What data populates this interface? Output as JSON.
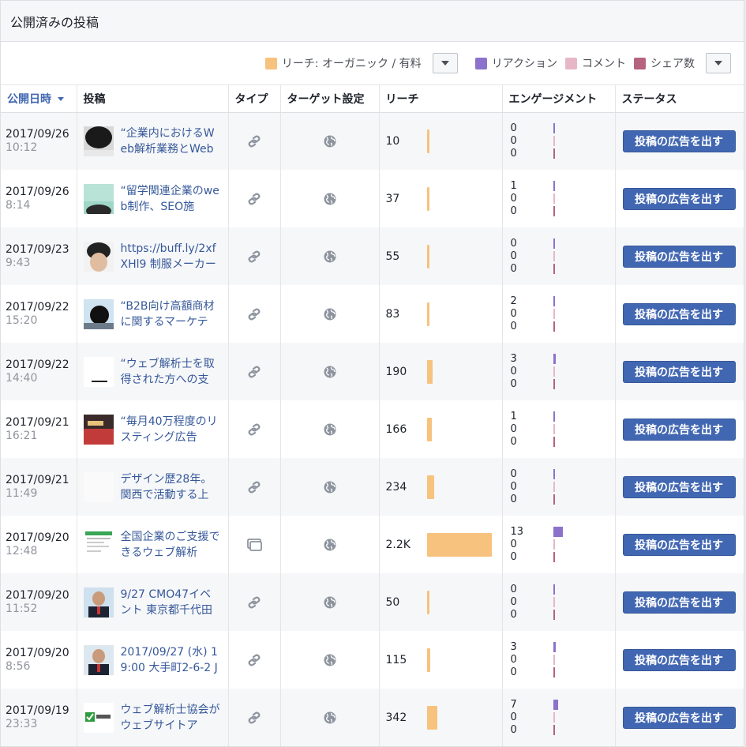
{
  "header": {
    "title": "公開済みの投稿"
  },
  "legend": {
    "reach": {
      "label": "リーチ: オーガニック / 有料",
      "color": "#f7c27d"
    },
    "reaction": {
      "label": "リアクション",
      "color": "#8c72cb"
    },
    "comment": {
      "label": "コメント",
      "color": "#e7b7c8"
    },
    "share": {
      "label": "シェア数",
      "color": "#b5637f"
    }
  },
  "columns": {
    "published": "公開日時",
    "post": "投稿",
    "type": "タイプ",
    "targeting": "ターゲット設定",
    "reach": "リーチ",
    "engagement": "エンゲージメント",
    "status": "ステータス"
  },
  "boost_label": "投稿の広告を出す",
  "rows": [
    {
      "date": "2017/09/26",
      "time": "10:12",
      "text": "“企業内におけるWeb解析業務とWeb",
      "type": "link-icon",
      "reach": "10",
      "reach_value": 10,
      "eng": [
        "0",
        "0",
        "0"
      ],
      "thumb": "t1"
    },
    {
      "date": "2017/09/26",
      "time": "8:14",
      "text": "“留学関連企業のweb制作、SEO施",
      "type": "link-icon",
      "reach": "37",
      "reach_value": 37,
      "eng": [
        "1",
        "0",
        "0"
      ],
      "thumb": "t2"
    },
    {
      "date": "2017/09/23",
      "time": "9:43",
      "text": "https://buff.ly/2xfXHl9 制服メーカー",
      "type": "link-icon",
      "reach": "55",
      "reach_value": 55,
      "eng": [
        "0",
        "0",
        "0"
      ],
      "thumb": "t3"
    },
    {
      "date": "2017/09/22",
      "time": "15:20",
      "text": "“B2B向け高額商材に関するマーケテ",
      "type": "link-icon",
      "reach": "83",
      "reach_value": 83,
      "eng": [
        "2",
        "0",
        "0"
      ],
      "thumb": "t4"
    },
    {
      "date": "2017/09/22",
      "time": "14:40",
      "text": "“ウェブ解析士を取得された方への支",
      "type": "link-icon",
      "reach": "190",
      "reach_value": 190,
      "eng": [
        "3",
        "0",
        "0"
      ],
      "thumb": "t5"
    },
    {
      "date": "2017/09/21",
      "time": "16:21",
      "text": "“毎月40万程度のリスティング広告",
      "type": "link-icon",
      "reach": "166",
      "reach_value": 166,
      "eng": [
        "1",
        "0",
        "0"
      ],
      "thumb": "t6"
    },
    {
      "date": "2017/09/21",
      "time": "11:49",
      "text": "デザイン歴28年。関西で活動する上",
      "type": "link-icon",
      "reach": "234",
      "reach_value": 234,
      "eng": [
        "0",
        "0",
        "0"
      ],
      "thumb": "t7"
    },
    {
      "date": "2017/09/20",
      "time": "12:48",
      "text": "全国企業のご支援できるウェブ解析",
      "type": "album-icon",
      "reach": "2.2K",
      "reach_value": 2200,
      "eng": [
        "13",
        "0",
        "0"
      ],
      "thumb": "t8"
    },
    {
      "date": "2017/09/20",
      "time": "11:52",
      "text": "9/27 CMO47イベント 東京都千代田",
      "type": "link-icon",
      "reach": "50",
      "reach_value": 50,
      "eng": [
        "0",
        "0",
        "0"
      ],
      "thumb": "t9"
    },
    {
      "date": "2017/09/20",
      "time": "8:56",
      "text": "2017/09/27 (水) 19:00 大手町2-6-2 J",
      "type": "link-icon",
      "reach": "115",
      "reach_value": 115,
      "eng": [
        "3",
        "0",
        "0"
      ],
      "thumb": "t10"
    },
    {
      "date": "2017/09/19",
      "time": "23:33",
      "text": "ウェブ解析士協会がウェブサイトア",
      "type": "link-icon",
      "reach": "342",
      "reach_value": 342,
      "eng": [
        "7",
        "0",
        "0"
      ],
      "thumb": "t11"
    }
  ]
}
